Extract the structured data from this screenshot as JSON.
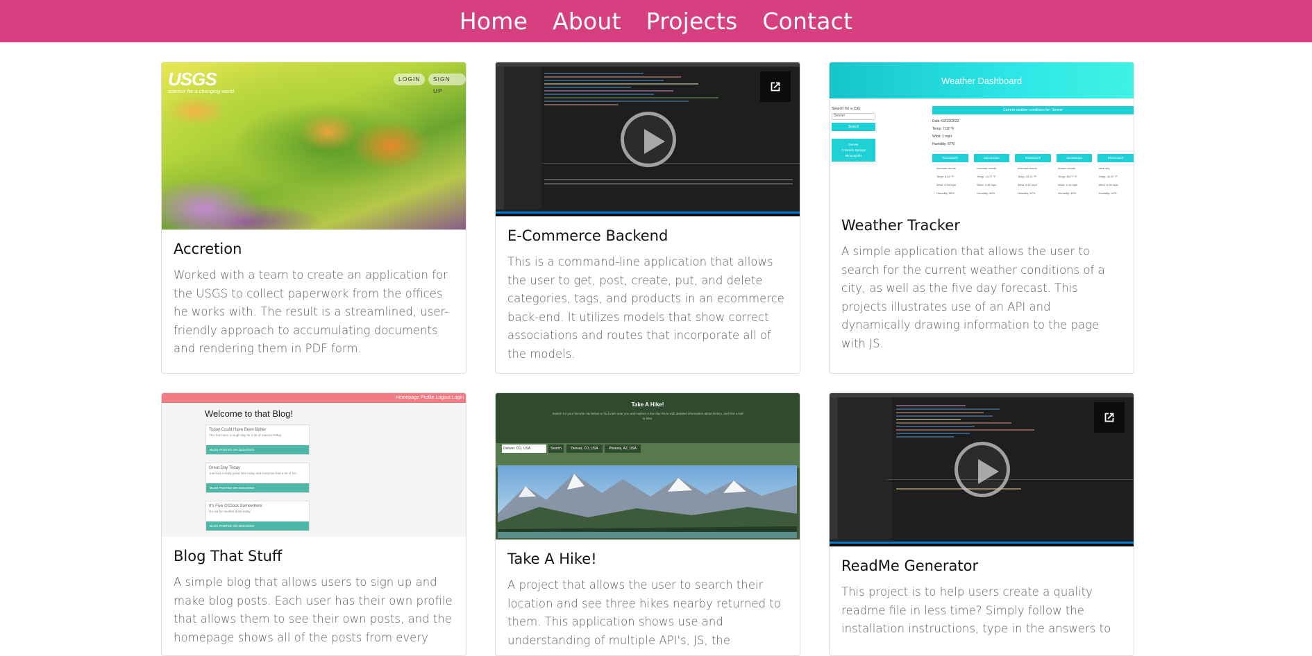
{
  "nav": {
    "links": [
      "Home",
      "About",
      "Projects",
      "Contact"
    ]
  },
  "colors": {
    "nav_bg": "#d63f80",
    "card_border": "#dcdcdc",
    "teal": "#4db8a8"
  },
  "projects": [
    {
      "title": "Accretion",
      "description": "Worked with a team to create an application for the USGS to collect paperwork from the offices he works with. The result is a streamlined, user-friendly approach to accumulating documents and rendering them in PDF form.",
      "image": {
        "logo_text": "USGS",
        "logo_tagline": "science for a changing world",
        "buttons": [
          "LOGIN",
          "SIGN UP"
        ]
      }
    },
    {
      "title": "E-Commerce Backend",
      "description": "This is a command-line application that allows the user to get, post, create, put, and delete categories, tags, and products in an ecommerce back-end. It utilizes models that show correct associations and routes that incorporate all of the models.",
      "image": {
        "type": "video",
        "icons": [
          "play-icon",
          "external-link-icon"
        ]
      }
    },
    {
      "title": "Weather Tracker",
      "description": "A simple application that allows the user to search for the current weather conditions of a city, as well as the five day forecast. This projects illustrates use of an API and dynamically drawing information to the page with JS.",
      "image": {
        "header": "Weather Dashboard",
        "search_label": "Search for a City:",
        "search_value": "Denver",
        "search_button": "Search",
        "history": [
          "Denver",
          "Colorado Springs",
          "Minneapolis"
        ],
        "current_title": "Current weather conditions for: Denver",
        "current_lines": [
          "Date: 02/22/2022",
          "Temp: 7.02 °F",
          "Wind: 1 mph",
          "Humidity: 67%"
        ],
        "forecast_days": [
          "02/23/2022",
          "02/24/2022",
          "02/25/2022",
          "02/26/2022",
          "02/27/2022"
        ],
        "forecast_rows": [
          [
            "overcast clouds",
            "overcast clouds",
            "overcast clouds",
            "broken clouds",
            "clear sky"
          ],
          [
            "Temp: 6.62 °F",
            "Temp: 14.77 °F",
            "Temp: 22.21 °F",
            "Temp: 35.77 °F",
            "Temp: 41.57 °F"
          ],
          [
            "Wind: 6.54 mph",
            "Wind: 2.06 mph",
            "Wind: 3.81 mph",
            "Wind: 4.16 mph",
            "Wind: 6.05 mph"
          ],
          [
            "Humidity: 59%",
            "Humidity: 46%",
            "Humidity: 67%",
            "Humidity: 40%",
            "Humidity: 42%"
          ]
        ]
      }
    },
    {
      "title": "Blog That Stuff",
      "description": "A simple blog that allows users to sign up and make blog posts. Each user has their own profile that allows them to see their own posts, and the homepage shows all of the posts from every",
      "image": {
        "nav_text": "Homepage Profile Logout Login",
        "header": "Welcome to that Blog!",
        "posts": [
          {
            "title": "Today Could Have Been Better",
            "text": "This has been a rough day for a lot of reasons today.",
            "footer": "BLOG     POSTED ON 02/24/2022"
          },
          {
            "title": "Great Day Today",
            "text": "Just had a really great time today and everyone had a lot of fun.",
            "footer": "BLOG     POSTED ON 02/24/2022"
          },
          {
            "title": "It's Five O'Clock Somewhere",
            "text": "Go out for another drink today.",
            "footer": "BLOG     POSTED ON 02/24/2022"
          }
        ]
      }
    },
    {
      "title": "Take A Hike!",
      "description": "A project that allows the user to search their location and see three hikes nearby returned to them. This application shows use and understanding of multiple API's, JS, the",
      "image": {
        "header": "Take A Hike!",
        "subtitle": "Search for your favorite city below to find trails near you and explore a few day hikes with detailed information about history, and find a trail to hike.",
        "search_value": "Denver, CO, USA",
        "search_button": "Search",
        "history": [
          "Denver, CO, USA",
          "Phoenix, AZ, USA"
        ]
      }
    },
    {
      "title": "ReadMe Generator",
      "description": "This project is to help users create a quality readme file in less time? Simply follow the installation instructions, type in the answers to",
      "image": {
        "type": "video",
        "icons": [
          "play-icon",
          "external-link-icon"
        ]
      }
    }
  ]
}
